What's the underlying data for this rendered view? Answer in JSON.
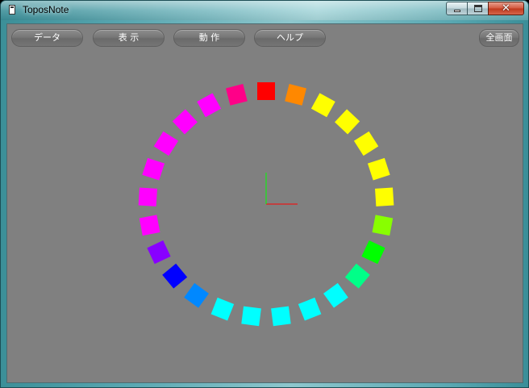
{
  "window": {
    "title": "ToposNote",
    "close_glyph": "✕"
  },
  "toolbar": {
    "data_label": "データ",
    "view_label": "表 示",
    "action_label": "動 作",
    "help_label": "ヘルプ",
    "fullscreen_label": "全画面"
  },
  "scene": {
    "background_color": "#808080",
    "marker_colors": [
      "#ff0000",
      "#ff8800",
      "#ffff00",
      "#ffff00",
      "#ffff00",
      "#ffff00",
      "#ffff00",
      "#88ff00",
      "#00ff00",
      "#00ff88",
      "#00ffff",
      "#00ffff",
      "#00ffff",
      "#00ffff",
      "#00ffff",
      "#0088ff",
      "#0000ff",
      "#8800ff",
      "#ff00ff",
      "#ff00ff",
      "#ff00ff",
      "#ff00ff",
      "#ff00ff",
      "#ff00ff",
      "#ff0088"
    ],
    "axis_x_color": "#ff0000",
    "axis_y_color": "#00ff00"
  }
}
